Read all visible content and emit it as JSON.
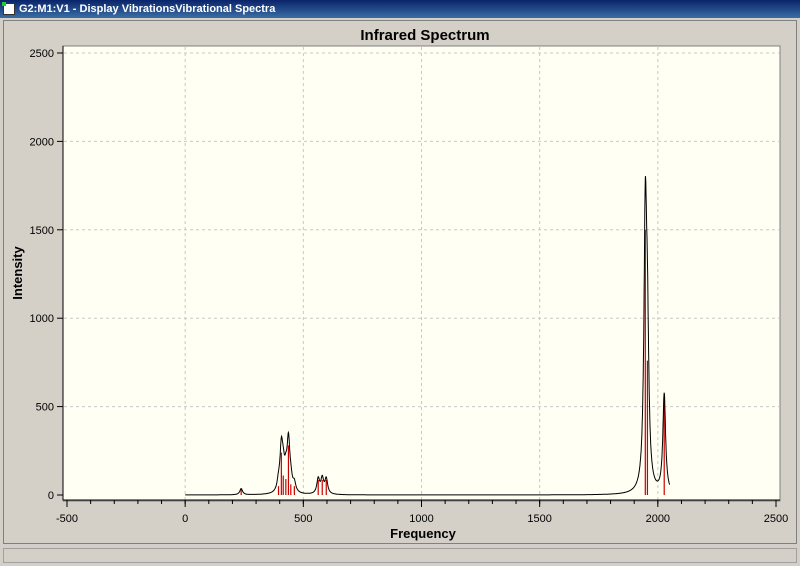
{
  "window": {
    "title": "G2:M1:V1 - Display VibrationsVibrational Spectra"
  },
  "chart_data": {
    "type": "line",
    "title": "Infrared Spectrum",
    "xlabel": "Frequency",
    "ylabel": "Intensity",
    "xlim": [
      -500,
      2500
    ],
    "ylim": [
      0,
      2500
    ],
    "xticks": [
      "-500",
      "0",
      "500",
      "1000",
      "1500",
      "2000",
      "2500"
    ],
    "yticks": [
      "0",
      "500",
      "1000",
      "1500",
      "2000",
      "2500"
    ],
    "grid": true,
    "curve_range": [
      0,
      2050
    ],
    "hwhm": 7,
    "sticks": [
      {
        "freq": 237,
        "intensity": 35
      },
      {
        "freq": 395,
        "intensity": 50
      },
      {
        "freq": 407,
        "intensity": 240
      },
      {
        "freq": 415,
        "intensity": 110
      },
      {
        "freq": 426,
        "intensity": 90
      },
      {
        "freq": 437,
        "intensity": 280
      },
      {
        "freq": 447,
        "intensity": 60
      },
      {
        "freq": 462,
        "intensity": 50
      },
      {
        "freq": 563,
        "intensity": 85
      },
      {
        "freq": 580,
        "intensity": 85
      },
      {
        "freq": 597,
        "intensity": 85
      },
      {
        "freq": 1947,
        "intensity": 1500
      },
      {
        "freq": 1956,
        "intensity": 760
      },
      {
        "freq": 2027,
        "intensity": 560
      }
    ],
    "colors": {
      "curve": "#000000",
      "sticks": "#cc0000",
      "plot_bg": "#fffff4"
    }
  }
}
